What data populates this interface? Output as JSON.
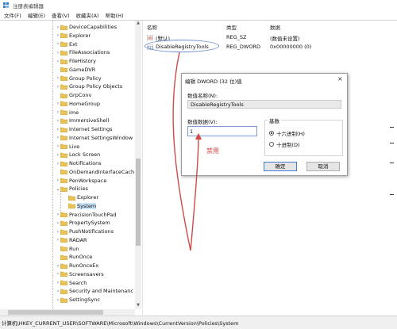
{
  "window": {
    "title": "注册表编辑器"
  },
  "menu": [
    "文件(F)",
    "编辑(E)",
    "查看(V)",
    "收藏夹(A)",
    "帮助(H)"
  ],
  "tree": {
    "items": [
      {
        "label": "DeviceCapabilities",
        "level": 1,
        "expand": ">"
      },
      {
        "label": "Explorer",
        "level": 1,
        "expand": ">"
      },
      {
        "label": "Ext",
        "level": 1,
        "expand": ">"
      },
      {
        "label": "FileAssociations",
        "level": 1,
        "expand": ">"
      },
      {
        "label": "FileHistory",
        "level": 1,
        "expand": ">"
      },
      {
        "label": "GameDVR",
        "level": 1,
        "expand": ""
      },
      {
        "label": "Group Policy",
        "level": 1,
        "expand": ">"
      },
      {
        "label": "Group Policy Objects",
        "level": 1,
        "expand": ">"
      },
      {
        "label": "GrpConv",
        "level": 1,
        "expand": ""
      },
      {
        "label": "HomeGroup",
        "level": 1,
        "expand": ">"
      },
      {
        "label": "ime",
        "level": 1,
        "expand": ">"
      },
      {
        "label": "ImmersiveShell",
        "level": 1,
        "expand": ">"
      },
      {
        "label": "Internet Settings",
        "level": 1,
        "expand": ">"
      },
      {
        "label": "Internet SettingsWindow",
        "level": 1,
        "expand": ">"
      },
      {
        "label": "Live",
        "level": 1,
        "expand": ">"
      },
      {
        "label": "Lock Screen",
        "level": 1,
        "expand": ">"
      },
      {
        "label": "Notifications",
        "level": 1,
        "expand": ">"
      },
      {
        "label": "OnDemandInterfaceCach",
        "level": 1,
        "expand": ""
      },
      {
        "label": "PenWorkspace",
        "level": 1,
        "expand": ">"
      },
      {
        "label": "Policies",
        "level": 1,
        "expand": "v"
      },
      {
        "label": "Explorer",
        "level": 2,
        "expand": ""
      },
      {
        "label": "System",
        "level": 2,
        "expand": "",
        "selected": true
      },
      {
        "label": "PrecisionTouchPad",
        "level": 1,
        "expand": ">"
      },
      {
        "label": "PropertySystem",
        "level": 1,
        "expand": ">"
      },
      {
        "label": "PushNotifications",
        "level": 1,
        "expand": ">"
      },
      {
        "label": "RADAR",
        "level": 1,
        "expand": ">"
      },
      {
        "label": "Run",
        "level": 1,
        "expand": ""
      },
      {
        "label": "RunOnce",
        "level": 1,
        "expand": ""
      },
      {
        "label": "RunOnceEx",
        "level": 1,
        "expand": ">"
      },
      {
        "label": "Screensavers",
        "level": 1,
        "expand": ">"
      },
      {
        "label": "Search",
        "level": 1,
        "expand": ">"
      },
      {
        "label": "Security and Maintenanc",
        "level": 1,
        "expand": ">"
      },
      {
        "label": "SettingSync",
        "level": 1,
        "expand": ">"
      }
    ]
  },
  "list": {
    "headers": [
      "名称",
      "类型",
      "数据"
    ],
    "rows": [
      {
        "name": "(默认)",
        "type": "REG_SZ",
        "data": "(数值未设置)",
        "icon": "string-value-icon"
      },
      {
        "name": "DisableRegistryTools",
        "type": "REG_DWORD",
        "data": "0x00000000 (0)",
        "icon": "dword-value-icon"
      }
    ]
  },
  "status": {
    "path": "计算机\\HKEY_CURRENT_USER\\SOFTWARE\\Microsoft\\Windows\\CurrentVersion\\Policies\\System"
  },
  "dialog": {
    "title": "编辑 DWORD (32 位)值",
    "close": "×",
    "name_label": "数值名称(N):",
    "name_value": "DisableRegistryTools",
    "data_label": "数值数据(V):",
    "data_value": "1",
    "base_label": "基数",
    "hex_label": "十六进制(H)",
    "dec_label": "十进制(D)",
    "base_selected": "hex",
    "ok": "确定",
    "cancel": "取消"
  },
  "annotation": {
    "text": "禁用",
    "color": "#d04a4a"
  },
  "colors": {
    "selection": "#cce4f7",
    "folder": "#e8c25a",
    "highlight_oval": "#6b8fd0"
  }
}
